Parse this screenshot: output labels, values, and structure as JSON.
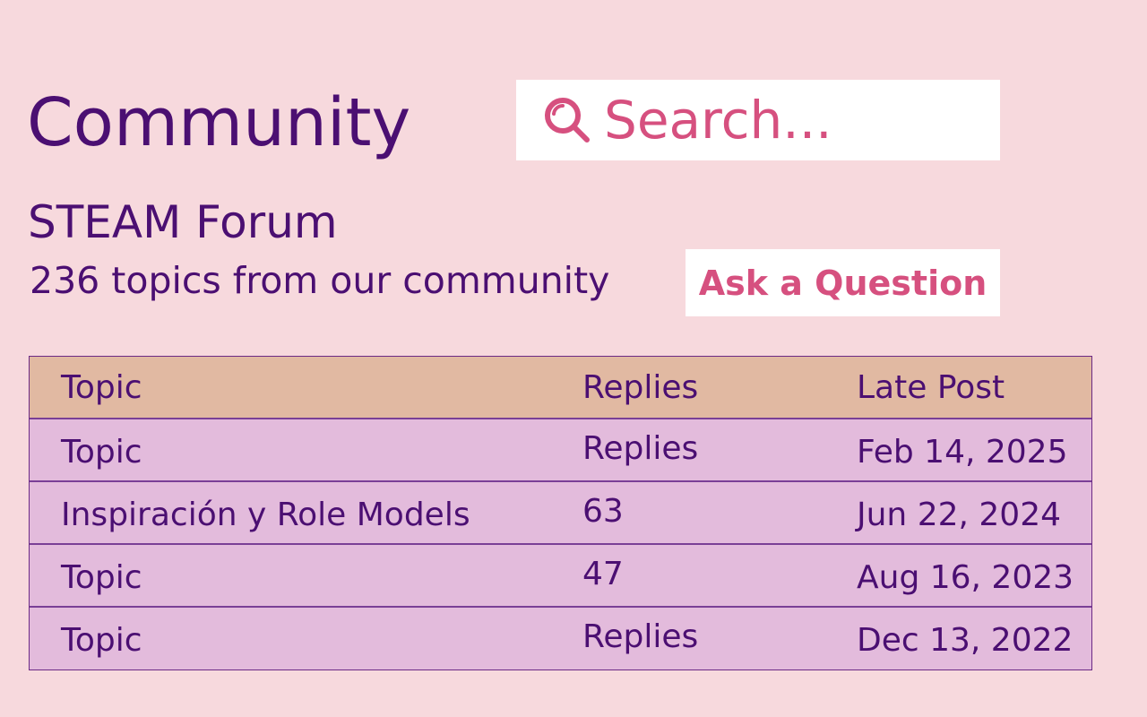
{
  "page": {
    "title": "Community"
  },
  "search": {
    "placeholder": "Search...",
    "icon": "search-icon"
  },
  "forum": {
    "title": "STEAM Forum",
    "subtitle": "236 topics from our community",
    "ask_label": "Ask a Question"
  },
  "table": {
    "columns": [
      "Topic",
      "Replies",
      "Late Post"
    ],
    "rows": [
      [
        "Topic",
        "Replies",
        "Feb 14, 2025"
      ],
      [
        "Inspiración y Role Models",
        "63",
        "Jun 22, 2024"
      ],
      [
        "Topic",
        "47",
        "Aug 16, 2023"
      ],
      [
        "Topic",
        "Replies",
        "Dec 13, 2022"
      ]
    ]
  },
  "colors": {
    "background": "#f7d9dd",
    "text": "#4b0f72",
    "accent": "#d6507f",
    "header_row": "#e1b9a2",
    "body_row": "#e3bbdc",
    "surface": "#ffffff"
  }
}
